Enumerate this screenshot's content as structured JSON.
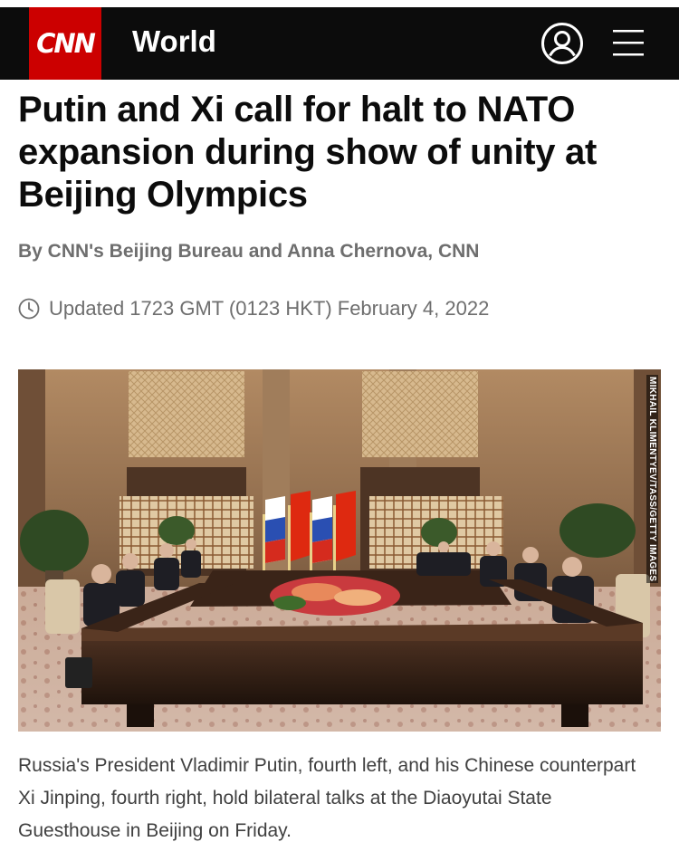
{
  "header": {
    "logo_text": "CNN",
    "section_title": "World",
    "account_icon": "user-circle-icon",
    "menu_icon": "hamburger-menu-icon",
    "brand_color": "#cc0000",
    "bar_color": "#0c0c0c"
  },
  "article": {
    "headline": "Putin and Xi call for halt to NATO expansion during show of unity at Beijing Olympics",
    "byline": "By CNN's Beijing Bureau and Anna Chernova, CNN",
    "updated": "Updated 1723 GMT (0123 HKT) February 4, 2022",
    "clock_icon": "clock-icon",
    "photo": {
      "description_icon": "news-photo",
      "credit": "MIKHAIL KLIMENTYEV/TASS/GETTY IMAGES"
    },
    "caption": "Russia's President Vladimir Putin, fourth left, and his Chinese counterpart Xi Jinping, fourth right, hold bilateral talks at the Diaoyutai State Guesthouse in Beijing on Friday."
  }
}
